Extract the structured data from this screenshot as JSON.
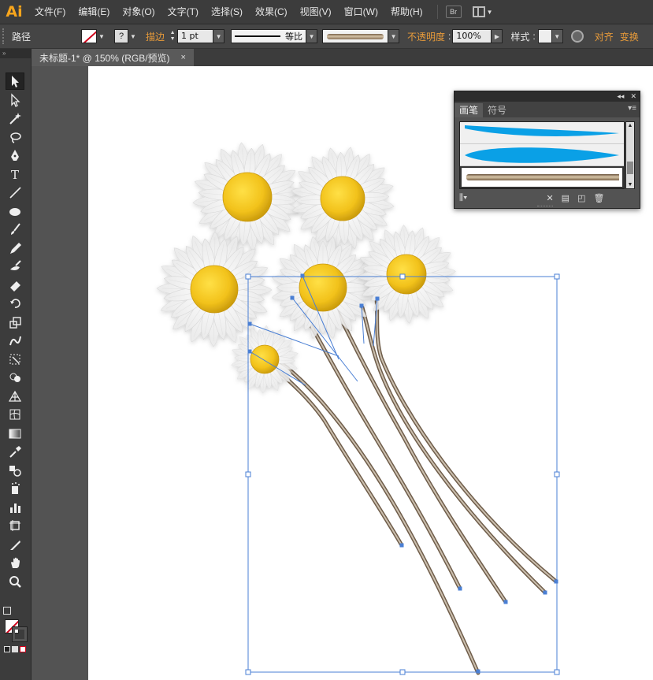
{
  "app": {
    "logo": "Ai"
  },
  "menu": {
    "items": [
      "文件(F)",
      "编辑(E)",
      "对象(O)",
      "文字(T)",
      "选择(S)",
      "效果(C)",
      "视图(V)",
      "窗口(W)",
      "帮助(H)"
    ],
    "bridge_label": "Br"
  },
  "control_bar": {
    "object_type": "路径",
    "stroke_label": "描边",
    "stroke_weight": "1 pt",
    "stroke_profile": "等比",
    "opacity_label": "不透明度",
    "opacity_value": "100%",
    "style_label": "样式",
    "align_label": "对齐",
    "transform_label": "变换",
    "fill_swatch": "none",
    "stroke_swatch_symbol": "?"
  },
  "document_tab": {
    "title": "未标题-1* @ 150% (RGB/预览)",
    "close_glyph": "×"
  },
  "brushes_panel": {
    "tabs": [
      "画笔",
      "符号"
    ],
    "active_tab": "画笔",
    "brushes": [
      {
        "name": "blue-taper-brush",
        "color": "#0aa0e6"
      },
      {
        "name": "blue-leaf-brush",
        "color": "#0aa0e6"
      },
      {
        "name": "stem-brush",
        "color": "#9a8060"
      }
    ],
    "selected_index": 2
  },
  "tools": [
    "selection-tool",
    "direct-selection-tool",
    "magic-wand-tool",
    "lasso-tool",
    "pen-tool",
    "type-tool",
    "line-tool",
    "ellipse-tool",
    "paintbrush-tool",
    "pencil-tool",
    "blob-brush-tool",
    "eraser-tool",
    "rotate-tool",
    "scale-tool",
    "warp-tool",
    "free-transform-tool",
    "shape-builder-tool",
    "perspective-grid-tool",
    "mesh-tool",
    "gradient-tool",
    "eyedropper-tool",
    "blend-tool",
    "symbol-sprayer-tool",
    "column-graph-tool",
    "artboard-tool",
    "slice-tool",
    "hand-tool",
    "zoom-tool"
  ],
  "colors": {
    "accent": "#e89b3a",
    "logo": "#f7a51c",
    "selection": "#4a7fd4",
    "daisy_center": "#f2c21b",
    "stem": "#9a8a76"
  }
}
